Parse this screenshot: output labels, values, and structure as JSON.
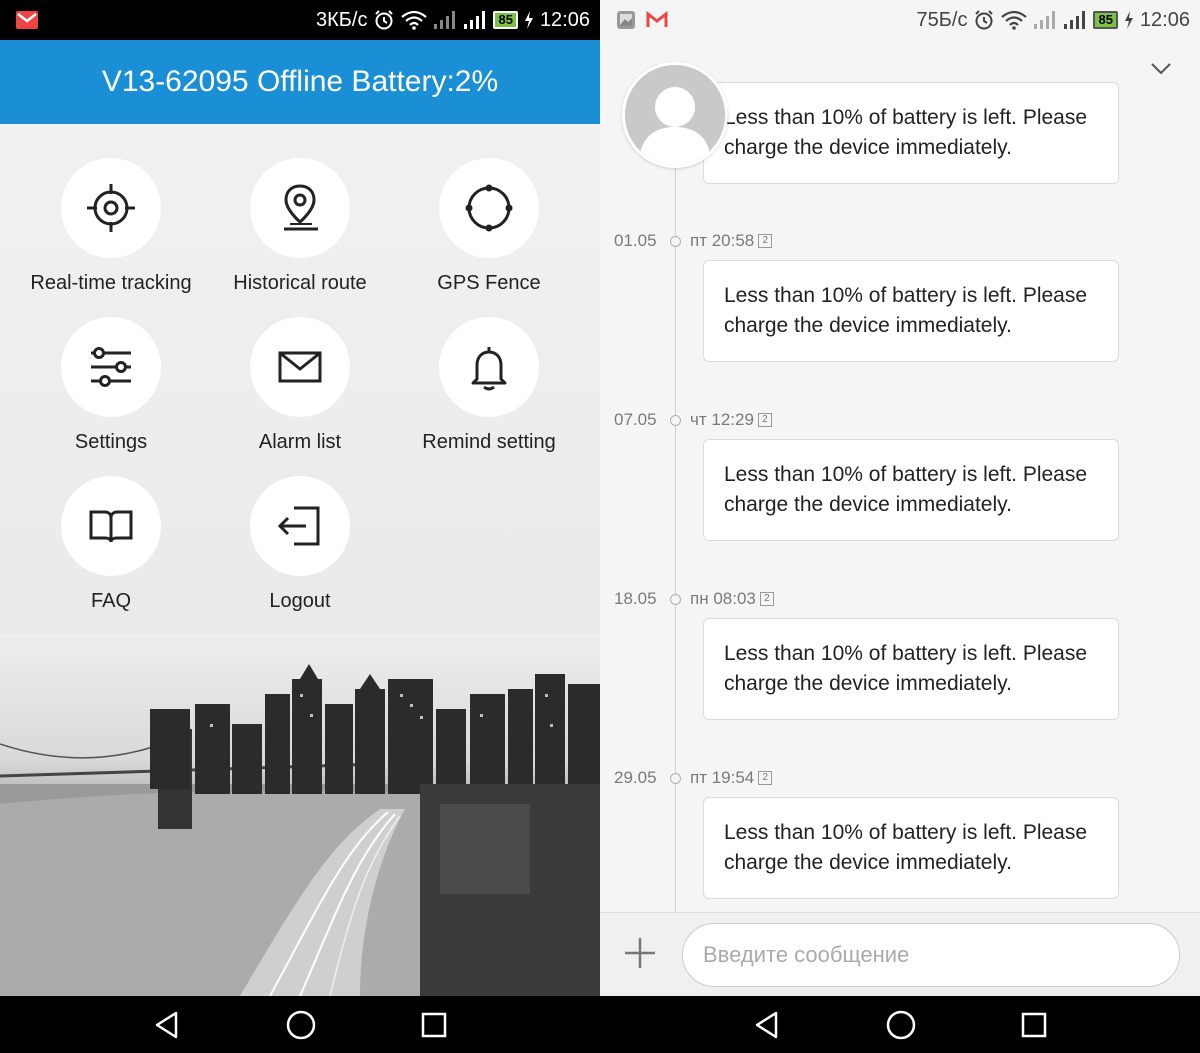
{
  "left": {
    "status": {
      "speed": "3КБ/с",
      "battery": "85",
      "time": "12:06"
    },
    "header_title": "V13-62095 Offline Battery:2%",
    "menu": [
      {
        "label": "Real-time tracking",
        "icon": "crosshair-icon"
      },
      {
        "label": "Historical route",
        "icon": "location-pin-icon"
      },
      {
        "label": "GPS Fence",
        "icon": "fence-circle-icon"
      },
      {
        "label": "Settings",
        "icon": "sliders-icon"
      },
      {
        "label": "Alarm list",
        "icon": "envelope-icon"
      },
      {
        "label": "Remind setting",
        "icon": "bell-icon"
      },
      {
        "label": "FAQ",
        "icon": "book-icon"
      },
      {
        "label": "Logout",
        "icon": "logout-icon"
      }
    ]
  },
  "right": {
    "status": {
      "speed": "75Б/с",
      "battery": "85",
      "time": "12:06"
    },
    "messages": [
      {
        "date": "",
        "time": "",
        "text": "Less than 10% of battery is left. Please charge the device immediately."
      },
      {
        "date": "01.05",
        "time": "пт 20:58",
        "sim": "2",
        "text": "Less than 10% of battery is left. Please charge the device immediately."
      },
      {
        "date": "07.05",
        "time": "чт 12:29",
        "sim": "2",
        "text": "Less than 10% of battery is left. Please charge the device immediately."
      },
      {
        "date": "18.05",
        "time": "пн 08:03",
        "sim": "2",
        "text": "Less than 10% of battery is left. Please charge the device immediately."
      },
      {
        "date": "29.05",
        "time": "пт 19:54",
        "sim": "2",
        "text": "Less than 10% of battery is left. Please charge the device immediately."
      }
    ],
    "composer": {
      "placeholder": "Введите сообщение"
    }
  },
  "colors": {
    "header_blue": "#1a8fd6",
    "battery_green": "#7cc242"
  }
}
